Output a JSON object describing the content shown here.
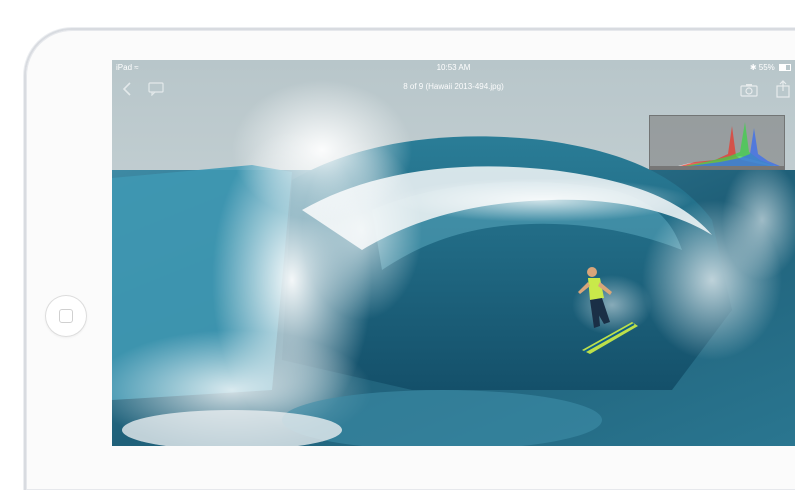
{
  "statusbar": {
    "device": "iPad",
    "time": "10:53 AM",
    "battery": "55%"
  },
  "photo_viewer": {
    "title": "8 of 9 (Hawaii 2013-494.jpg)"
  },
  "icons": [
    "back-icon",
    "comment-icon",
    "camera-icon",
    "share-icon",
    "wifi-icon",
    "bluetooth-icon",
    "battery-icon",
    "home-button"
  ],
  "colors": {
    "ocean": "#2d6e86",
    "foam": "#eef3f4",
    "histogram_red": "#e83a2d",
    "histogram_green": "#3fd24a",
    "histogram_blue": "#3a6df0"
  }
}
